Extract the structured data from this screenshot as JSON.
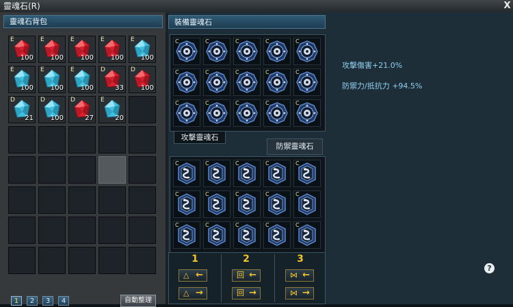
{
  "window": {
    "title": "靈魂石(R)",
    "close_label": "X"
  },
  "bag": {
    "title": "靈魂石背包",
    "slots": [
      {
        "grade": "E",
        "color": "red",
        "qty": "100"
      },
      {
        "grade": "E",
        "color": "red",
        "qty": "100"
      },
      {
        "grade": "E",
        "color": "red",
        "qty": "100"
      },
      {
        "grade": "E",
        "color": "red",
        "qty": "100"
      },
      {
        "grade": "E",
        "color": "blue",
        "qty": "100"
      },
      {
        "grade": "E",
        "color": "blue",
        "qty": "100"
      },
      {
        "grade": "E",
        "color": "blue",
        "qty": "100"
      },
      {
        "grade": "E",
        "color": "blue",
        "qty": "100"
      },
      {
        "grade": "D",
        "color": "red",
        "qty": "33"
      },
      {
        "grade": "D",
        "color": "red",
        "qty": "100"
      },
      {
        "grade": "D",
        "color": "blue",
        "qty": "21"
      },
      {
        "grade": "D",
        "color": "blue",
        "qty": "100"
      },
      {
        "grade": "D",
        "color": "red",
        "qty": "27"
      },
      {
        "grade": "E",
        "color": "blue",
        "qty": "20"
      }
    ],
    "selected_empty_slot": 23,
    "pages": [
      "1",
      "2",
      "3",
      "4"
    ],
    "active_page": "1",
    "sort_label": "自動整理"
  },
  "equip": {
    "title": "裝備靈魂石",
    "attack_tab": "攻擊靈魂石",
    "defense_tab": "防禦靈魂石",
    "slot_grade": "C",
    "attack_slot_count": 15,
    "defense_slot_count": 15
  },
  "stats": {
    "attack": "攻擊傷害+21.0%",
    "defense": "防禦力/抵抗力 +94.5%"
  },
  "presets": {
    "numbers": [
      "1",
      "2",
      "3"
    ],
    "symbols": [
      "△",
      "回",
      "⋈"
    ],
    "load_arrow": "←",
    "save_arrow": "→"
  },
  "help_label": "?",
  "colors": {
    "gem_red": "#d8202e",
    "gem_blue": "#3fc0e0",
    "accent_yellow": "#f2c42b",
    "stat_text": "#8fd0f0"
  }
}
